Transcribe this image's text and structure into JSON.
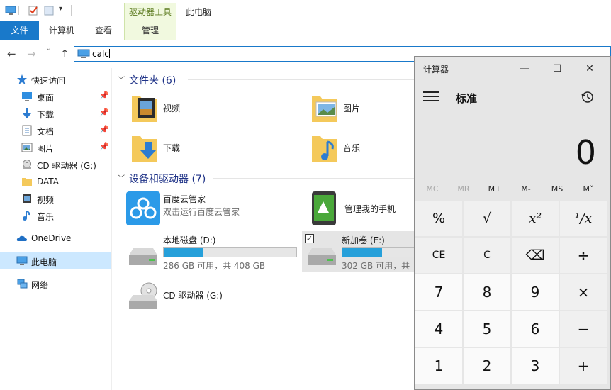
{
  "explorer": {
    "title": "此电脑",
    "context_tab_header": "驱动器工具",
    "tabs": [
      {
        "label": "文件"
      },
      {
        "label": "计算机"
      },
      {
        "label": "查看"
      },
      {
        "label": "管理"
      }
    ],
    "address": {
      "value": "calc"
    },
    "nav": [
      {
        "label": "快速访问",
        "icon": "star-icon"
      },
      {
        "label": "桌面",
        "icon": "desktop-icon",
        "pinned": true
      },
      {
        "label": "下载",
        "icon": "download-icon",
        "pinned": true
      },
      {
        "label": "文档",
        "icon": "document-icon",
        "pinned": true
      },
      {
        "label": "图片",
        "icon": "picture-icon",
        "pinned": true
      },
      {
        "label": "CD 驱动器 (G:)",
        "icon": "cd-drive-icon"
      },
      {
        "label": "DATA",
        "icon": "folder-icon"
      },
      {
        "label": "视频",
        "icon": "video-icon"
      },
      {
        "label": "音乐",
        "icon": "music-icon"
      },
      {
        "label": "OneDrive",
        "icon": "onedrive-icon"
      },
      {
        "label": "此电脑",
        "icon": "this-pc-icon",
        "selected": true
      },
      {
        "label": "网络",
        "icon": "network-icon"
      }
    ],
    "folders_header": "文件夹 (6)",
    "folders": [
      {
        "label": "视频",
        "icon": "video-folder-icon"
      },
      {
        "label": "图片",
        "icon": "picture-folder-icon"
      },
      {
        "label": "下载",
        "icon": "download-folder-icon"
      },
      {
        "label": "音乐",
        "icon": "music-folder-icon"
      }
    ],
    "devices_header": "设备和驱动器 (7)",
    "devices": [
      {
        "name": "百度云管家",
        "sub": "双击运行百度云管家",
        "icon": "baidu-cloud-icon"
      },
      {
        "name": "管理我的手机",
        "icon": "phone-manager-icon"
      },
      {
        "name": "本地磁盘 (D:)",
        "free": "286 GB 可用，共 408 GB",
        "used_fraction": 0.3,
        "icon": "hard-drive-icon"
      },
      {
        "name": "新加卷 (E:)",
        "free": "302 GB 可用，共",
        "used_fraction": 0.3,
        "icon": "hard-drive-icon",
        "selected": true
      },
      {
        "name": "CD 驱动器 (G:)",
        "icon": "cd-drive-icon"
      }
    ]
  },
  "calculator": {
    "title": "计算器",
    "mode": "标准",
    "display": "0",
    "memory": [
      "MC",
      "MR",
      "M+",
      "M-",
      "MS",
      "M˅"
    ],
    "keys": [
      [
        "%",
        "√",
        "x²",
        "¹/x"
      ],
      [
        "CE",
        "C",
        "⌫",
        "÷"
      ],
      [
        "7",
        "8",
        "9",
        "×"
      ],
      [
        "4",
        "5",
        "6",
        "−"
      ],
      [
        "1",
        "2",
        "3",
        "+"
      ]
    ]
  },
  "colors": {
    "accent": "#1979ca",
    "context_tab": "#f1f9df",
    "selection": "#cce8ff",
    "drive_bar": "#26a0da"
  }
}
